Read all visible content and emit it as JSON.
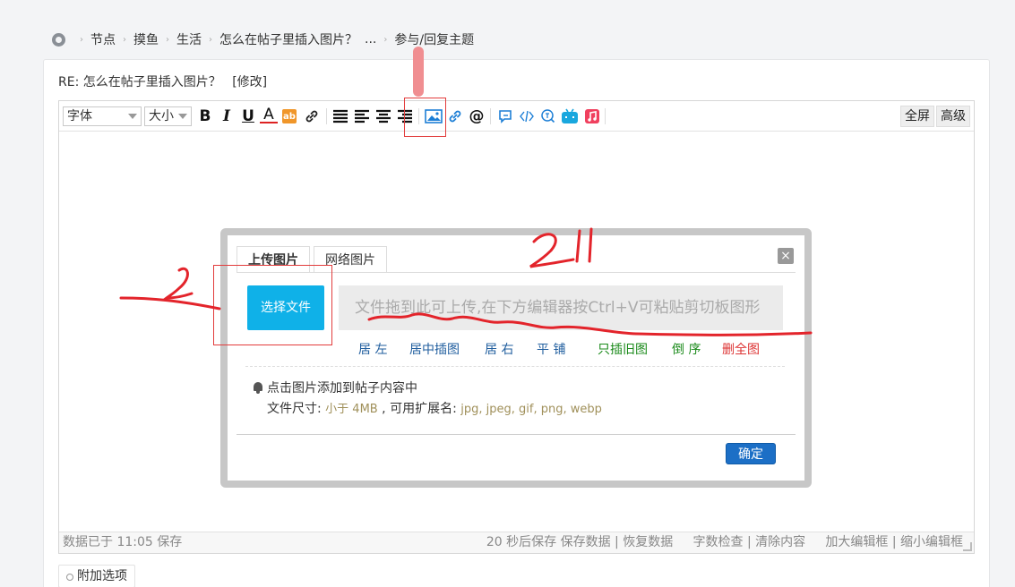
{
  "breadcrumb": {
    "items": [
      "节点",
      "摸鱼",
      "生活",
      "怎么在帖子里插入图片？",
      "...",
      "参与/回复主题"
    ]
  },
  "post": {
    "title": "RE: 怎么在帖子里插入图片？",
    "edit_label": "[修改]"
  },
  "toolbar": {
    "font_select": "字体",
    "size_select": "大小",
    "bold": "B",
    "italic": "I",
    "underline": "U",
    "font_color": "A",
    "bg_color": "ab",
    "fullscreen": "全屏",
    "advanced": "高级",
    "icons": [
      "link-icon",
      "align-justify-icon",
      "align-left-icon",
      "align-center-icon",
      "align-right-icon",
      "image-icon",
      "url-icon",
      "at-icon",
      "quote-icon",
      "code-icon",
      "emoji-icon",
      "bilibili-icon",
      "music-icon"
    ]
  },
  "statusbar": {
    "saved_text": "数据已于 11:05 保存",
    "autosave_text": "20 秒后保存",
    "save_data": "保存数据",
    "restore_data": "恢复数据",
    "word_check": "字数检查",
    "clear_content": "清除内容",
    "enlarge": "加大编辑框",
    "shrink": "缩小编辑框"
  },
  "extra_options": "附加选项",
  "dialog": {
    "tab_upload": "上传图片",
    "tab_web": "网络图片",
    "close": "×",
    "choose_file": "选择文件",
    "drop_hint": "文件拖到此可上传,在下方编辑器按Ctrl+V可粘贴剪切板图形",
    "options": [
      "居 左",
      "居中插图",
      "居 右",
      "平 铺",
      "只插旧图",
      "倒 序",
      "删全图"
    ],
    "tip_line1": "点击图片添加到帖子内容中",
    "tip_size_label": "文件尺寸:",
    "tip_size_value": "小于 4MB",
    "tip_ext_label": ", 可用扩展名:",
    "tip_ext_value": "jpg, jpeg, gif, png, webp",
    "ok": "确定"
  },
  "annotations": {
    "label_2": "2",
    "label_2b": "2\"",
    "color_red": "#e23c3c",
    "color_pink": "#f08e91"
  }
}
